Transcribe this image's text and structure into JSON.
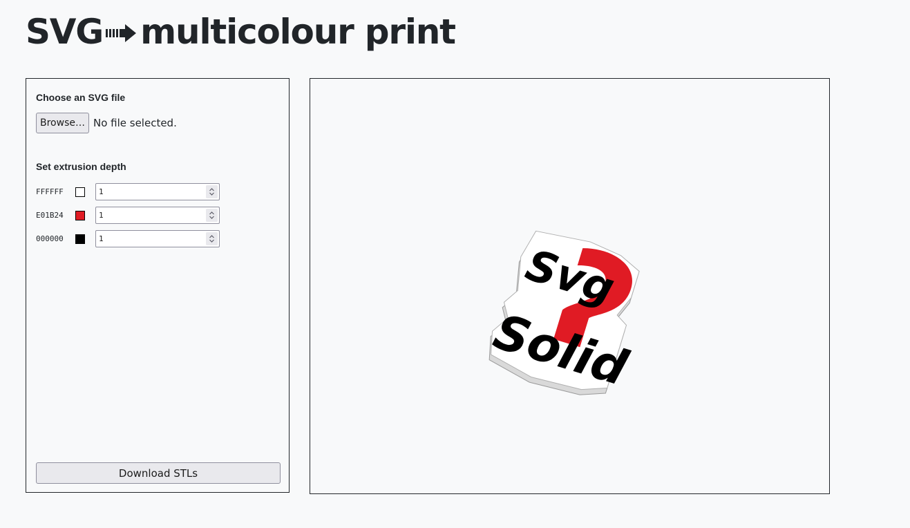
{
  "header": {
    "title_left": "SVG",
    "title_right": "multicolour print",
    "arrow_icon": "heavy-right-arrow-icon"
  },
  "controls": {
    "file_heading": "Choose an SVG file",
    "browse_label": "Browse…",
    "file_status": "No file selected.",
    "depth_heading": "Set extrusion depth",
    "colors": [
      {
        "hex": "FFFFFF",
        "swatch": "#FFFFFF",
        "depth": "1"
      },
      {
        "hex": "E01B24",
        "swatch": "#E01B24",
        "depth": "1"
      },
      {
        "hex": "000000",
        "swatch": "#000000",
        "depth": "1"
      }
    ],
    "download_label": "Download STLs"
  },
  "preview": {
    "model_words": [
      "Svg",
      "Solid"
    ],
    "model_colors": {
      "base": "#FFFFFF",
      "accent": "#E01B24",
      "text": "#000000"
    }
  }
}
